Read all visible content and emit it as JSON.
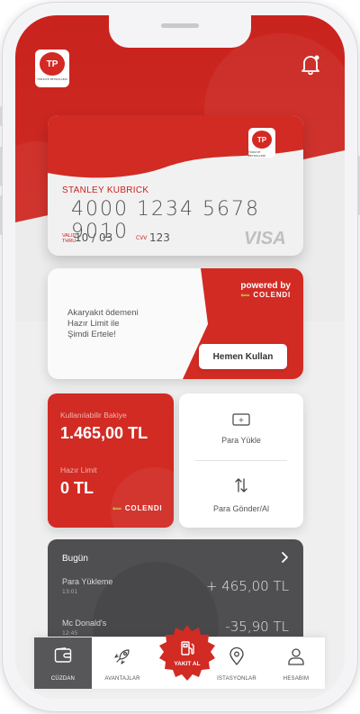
{
  "brand": {
    "logo_text": "TP",
    "logo_caption": "TÜRKİYE PETROLLERİ",
    "primary_color": "#d12b24",
    "dark_color": "#4f4f51"
  },
  "header": {
    "notification_icon": "bell-icon"
  },
  "card": {
    "holder_name": "STANLEY KUBRICK",
    "number": "4000 1234 5678 9010",
    "valid_thru_label_1": "VALID",
    "valid_thru_label_2": "THRU",
    "valid_thru": "10 / 03",
    "cvv_label": "CVV",
    "cvv": "123",
    "network": "VISA"
  },
  "promo": {
    "text": "Akaryakıt ödemeni\nHazır Limit ile\nŞimdi Ertele!",
    "powered_by": "powered by",
    "partner": "COLENDI",
    "button_label": "Hemen Kullan"
  },
  "balance": {
    "available_label": "Kullanılabilir Bakiye",
    "available_value": "1.465,00 TL",
    "limit_label": "Hazır Limit",
    "limit_value": "0 TL",
    "partner": "COLENDI"
  },
  "actions": [
    {
      "label": "Para Yükle",
      "icon": "cash-icon"
    },
    {
      "label": "Para Gönder/Al",
      "icon": "transfer-arrows-icon"
    }
  ],
  "transactions": {
    "title": "Bugün",
    "items": [
      {
        "name": "Para Yükleme",
        "time": "13:01",
        "amount": "+ 465,00 TL"
      },
      {
        "name": "Mc Donald's",
        "time": "12:45",
        "amount": "-35,90 TL"
      }
    ]
  },
  "tabbar": {
    "items": [
      {
        "label": "CÜZDAN",
        "icon": "wallet-icon",
        "active": true
      },
      {
        "label": "AVANTAJLAR",
        "icon": "rocket-icon",
        "active": false
      },
      {
        "label": "YAKIT AL",
        "icon": "fuel-pump-icon",
        "active": false
      },
      {
        "label": "İSTASYONLAR",
        "icon": "location-pin-icon",
        "active": false
      },
      {
        "label": "HESABIM",
        "icon": "user-icon",
        "active": false
      }
    ]
  }
}
